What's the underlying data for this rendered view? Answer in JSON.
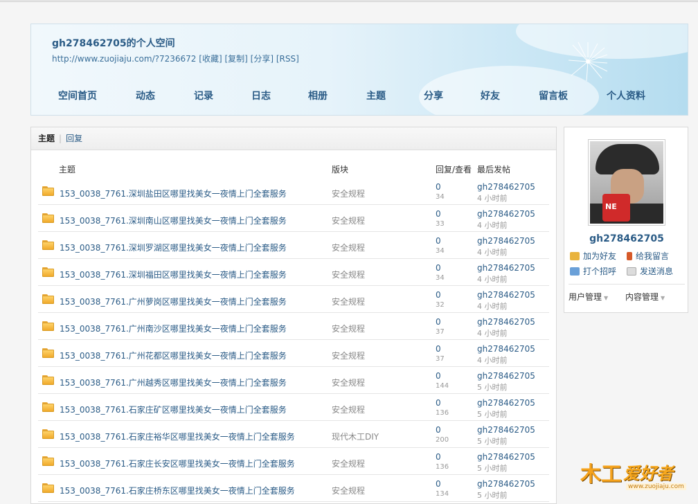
{
  "header": {
    "title": "gh278462705的个人空间",
    "url": "http://www.zuojiaju.com/?7236672",
    "links": [
      "[收藏]",
      "[复制]",
      "[分享]",
      "[RSS]"
    ],
    "nav": [
      "空间首页",
      "动态",
      "记录",
      "日志",
      "相册",
      "主题",
      "分享",
      "好友",
      "留言板",
      "个人资料"
    ]
  },
  "tabs": {
    "active": "主题",
    "other": "回复"
  },
  "table": {
    "columns": [
      "主题",
      "版块",
      "回复/查看",
      "最后发帖"
    ],
    "rows": [
      {
        "subject": "153_0038_7761.深圳盐田区哪里找美女一夜情上门全套服务",
        "board": "安全规程",
        "replies": "0",
        "views": "34",
        "poster": "gh278462705",
        "time": "4 小时前"
      },
      {
        "subject": "153_0038_7761.深圳南山区哪里找美女一夜情上门全套服务",
        "board": "安全规程",
        "replies": "0",
        "views": "33",
        "poster": "gh278462705",
        "time": "4 小时前"
      },
      {
        "subject": "153_0038_7761.深圳罗湖区哪里找美女一夜情上门全套服务",
        "board": "安全规程",
        "replies": "0",
        "views": "34",
        "poster": "gh278462705",
        "time": "4 小时前"
      },
      {
        "subject": "153_0038_7761.深圳福田区哪里找美女一夜情上门全套服务",
        "board": "安全规程",
        "replies": "0",
        "views": "34",
        "poster": "gh278462705",
        "time": "4 小时前"
      },
      {
        "subject": "153_0038_7761.广州萝岗区哪里找美女一夜情上门全套服务",
        "board": "安全规程",
        "replies": "0",
        "views": "32",
        "poster": "gh278462705",
        "time": "4 小时前"
      },
      {
        "subject": "153_0038_7761.广州南沙区哪里找美女一夜情上门全套服务",
        "board": "安全规程",
        "replies": "0",
        "views": "37",
        "poster": "gh278462705",
        "time": "4 小时前"
      },
      {
        "subject": "153_0038_7761.广州花都区哪里找美女一夜情上门全套服务",
        "board": "安全规程",
        "replies": "0",
        "views": "37",
        "poster": "gh278462705",
        "time": "4 小时前"
      },
      {
        "subject": "153_0038_7761.广州越秀区哪里找美女一夜情上门全套服务",
        "board": "安全规程",
        "replies": "0",
        "views": "144",
        "poster": "gh278462705",
        "time": "5 小时前"
      },
      {
        "subject": "153_0038_7761.石家庄矿区哪里找美女一夜情上门全套服务",
        "board": "安全规程",
        "replies": "0",
        "views": "136",
        "poster": "gh278462705",
        "time": "5 小时前"
      },
      {
        "subject": "153_0038_7761.石家庄裕华区哪里找美女一夜情上门全套服务",
        "board": "现代木工DIY",
        "replies": "0",
        "views": "200",
        "poster": "gh278462705",
        "time": "5 小时前"
      },
      {
        "subject": "153_0038_7761.石家庄长安区哪里找美女一夜情上门全套服务",
        "board": "安全规程",
        "replies": "0",
        "views": "136",
        "poster": "gh278462705",
        "time": "5 小时前"
      },
      {
        "subject": "153_0038_7761.石家庄桥东区哪里找美女一夜情上门全套服务",
        "board": "安全规程",
        "replies": "0",
        "views": "134",
        "poster": "gh278462705",
        "time": "5 小时前"
      }
    ]
  },
  "profile": {
    "avatar_text": "NE",
    "username": "gh278462705",
    "actions": [
      "加为好友",
      "给我留言",
      "打个招呼",
      "发送消息"
    ],
    "menus": [
      "用户管理",
      "内容管理"
    ]
  },
  "logo": {
    "mark": "木工",
    "text": "爱好者",
    "site": "www.zuojiaju.com"
  },
  "colors": {
    "link": "#2a5b86",
    "folder": "#f0aa2b",
    "muted": "#999999"
  }
}
